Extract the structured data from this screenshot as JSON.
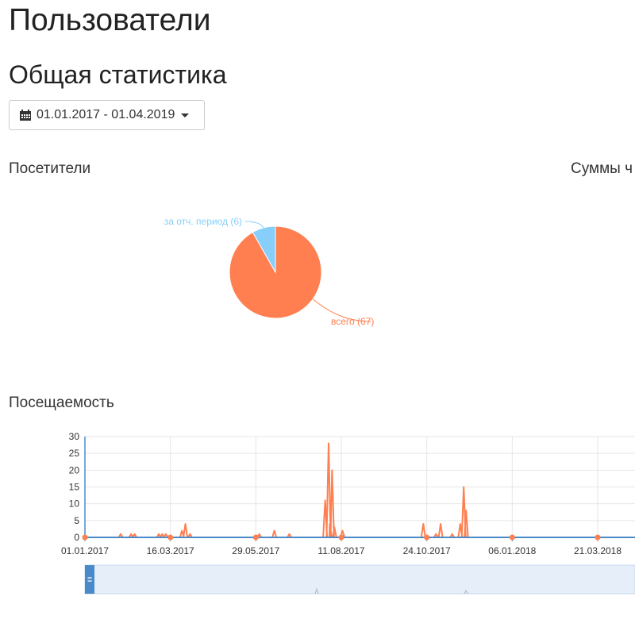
{
  "page": {
    "title": "Пользователи",
    "section_title": "Общая статистика"
  },
  "date_range": {
    "label": "01.01.2017 - 01.04.2019",
    "icon": "calendar-icon",
    "caret": "chevron-down-icon"
  },
  "panels": {
    "visitors_title": "Посетители",
    "sums_title": "Суммы ч",
    "attendance_title": "Посещаемость"
  },
  "colors": {
    "orange": "#ff7f50",
    "blue": "#87cefa",
    "axis_blue": "#4a8ac8",
    "navigator_fill": "#e6eefa"
  },
  "chart_data": [
    {
      "type": "pie",
      "title": "",
      "slices": [
        {
          "label": "всего (67)",
          "value": 67,
          "color": "#ff7f50"
        },
        {
          "label": "за отч. период (6)",
          "value": 6,
          "color": "#87cefa"
        }
      ]
    },
    {
      "type": "line",
      "title": "",
      "xlabel": "",
      "ylabel": "",
      "ylim": [
        0,
        30
      ],
      "yticks": [
        0,
        5,
        10,
        15,
        20,
        25,
        30
      ],
      "xticks": [
        "01.01.2017",
        "16.03.2017",
        "29.05.2017",
        "11.08.2017",
        "24.10.2017",
        "06.01.2018",
        "21.03.2018"
      ],
      "grid": true,
      "series": [
        {
          "color": "#ff7f50",
          "points": [
            [
              "2017-01-01",
              0
            ],
            [
              "2017-02-01",
              1
            ],
            [
              "2017-02-10",
              1
            ],
            [
              "2017-02-13",
              1
            ],
            [
              "2017-03-06",
              1
            ],
            [
              "2017-03-09",
              1
            ],
            [
              "2017-03-12",
              1
            ],
            [
              "2017-03-26",
              2
            ],
            [
              "2017-03-29",
              4
            ],
            [
              "2017-04-02",
              1
            ],
            [
              "2017-06-01",
              1
            ],
            [
              "2017-06-14",
              2
            ],
            [
              "2017-06-27",
              1
            ],
            [
              "2017-07-28",
              11
            ],
            [
              "2017-07-31",
              28
            ],
            [
              "2017-08-01",
              4
            ],
            [
              "2017-08-03",
              20
            ],
            [
              "2017-08-05",
              3
            ],
            [
              "2017-08-12",
              2
            ],
            [
              "2017-10-21",
              4
            ],
            [
              "2017-11-01",
              1
            ],
            [
              "2017-11-05",
              4
            ],
            [
              "2017-11-15",
              1
            ],
            [
              "2017-11-22",
              4
            ],
            [
              "2017-11-25",
              15
            ],
            [
              "2017-11-27",
              8
            ],
            [
              "2018-01-06",
              0
            ],
            [
              "2018-03-21",
              0
            ],
            [
              "2018-04-20",
              0
            ]
          ]
        }
      ]
    }
  ]
}
